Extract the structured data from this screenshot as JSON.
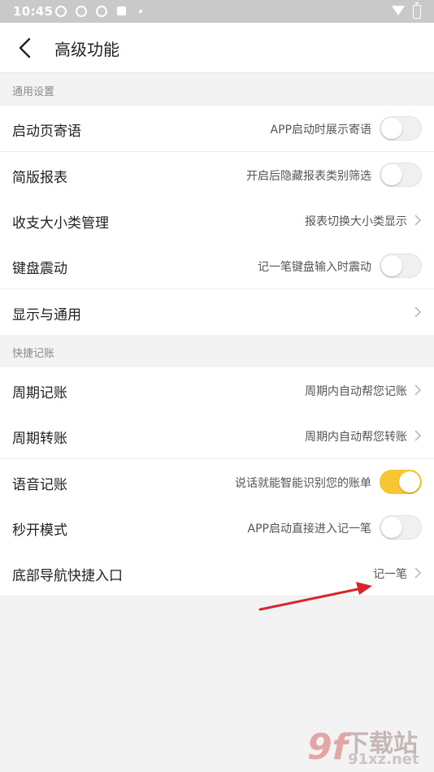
{
  "status_bar": {
    "time": "10:45"
  },
  "header": {
    "title": "高级功能"
  },
  "sections": [
    {
      "title": "通用设置",
      "rows": [
        {
          "label": "启动页寄语",
          "desc": "APP启动时展示寄语",
          "control": "toggle",
          "on": false
        },
        {
          "label": "简版报表",
          "desc": "开启后隐藏报表类别筛选",
          "control": "toggle",
          "on": false
        },
        {
          "label": "收支大小类管理",
          "desc": "报表切换大小类显示",
          "control": "chevron"
        },
        {
          "label": "键盘震动",
          "desc": "记一笔键盘输入时震动",
          "control": "toggle",
          "on": false
        },
        {
          "label": "显示与通用",
          "desc": "",
          "control": "chevron"
        }
      ]
    },
    {
      "title": "快捷记账",
      "rows": [
        {
          "label": "周期记账",
          "desc": "周期内自动帮您记账",
          "control": "chevron"
        },
        {
          "label": "周期转账",
          "desc": "周期内自动帮您转账",
          "control": "chevron"
        },
        {
          "label": "语音记账",
          "desc": "说话就能智能识别您的账单",
          "control": "toggle",
          "on": true
        },
        {
          "label": "秒开模式",
          "desc": "APP启动直接进入记一笔",
          "control": "toggle",
          "on": false
        },
        {
          "label": "底部导航快捷入口",
          "desc": "记一笔",
          "control": "chevron"
        }
      ]
    }
  ],
  "watermark": {
    "logo": "9f",
    "text1": "下载站",
    "text2": "91xz.net"
  },
  "colors": {
    "toggle_on": "#f8c631",
    "annotation_arrow": "#d9262b"
  }
}
